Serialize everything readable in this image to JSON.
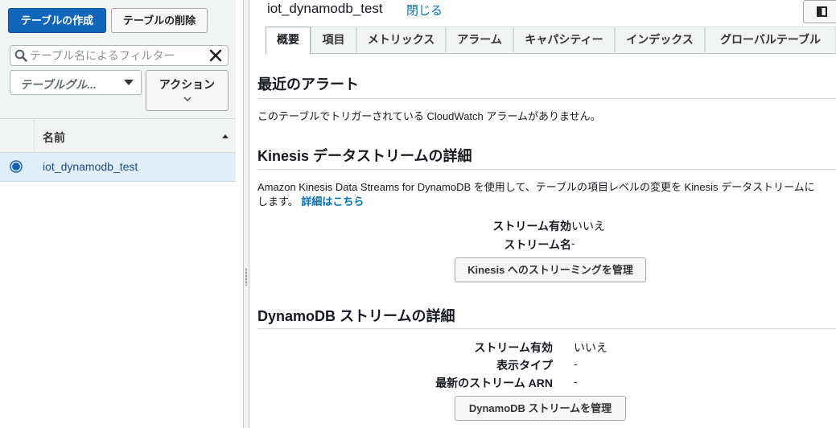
{
  "left": {
    "create_table_label": "テーブルの作成",
    "delete_table_label": "テーブルの削除",
    "filter_placeholder": "テーブル名によるフィルター",
    "table_group_label": "テーブルグル...",
    "actions_label": "アクション",
    "column_name": "名前",
    "rows": [
      {
        "name": "iot_dynamodb_test",
        "selected": true
      }
    ]
  },
  "right": {
    "title": "iot_dynamodb_test",
    "close_label": "閉じる",
    "tabs": [
      {
        "label": "概要",
        "active": true
      },
      {
        "label": "項目"
      },
      {
        "label": "メトリックス"
      },
      {
        "label": "アラーム"
      },
      {
        "label": "キャパシティー"
      },
      {
        "label": "インデックス"
      },
      {
        "label": "グローバルテーブル"
      }
    ],
    "alerts": {
      "heading": "最近のアラート",
      "message": "このテーブルでトリガーされている CloudWatch アラームがありません。"
    },
    "kinesis": {
      "heading": "Kinesis データストリームの詳細",
      "desc_line1": "Amazon Kinesis Data Streams for DynamoDB を使用して、テーブルの項目レベルの変更を Kinesis データストリームに",
      "desc_line2": "します。",
      "learn_more": "詳細はこちら",
      "stream_enabled_label": "ストリーム有効",
      "stream_enabled_value": "いいえ",
      "stream_name_label": "ストリーム名",
      "stream_name_value": "-",
      "manage_button": "Kinesis へのストリーミングを管理"
    },
    "dynamodb_stream": {
      "heading": "DynamoDB ストリームの詳細",
      "stream_enabled_label": "ストリーム有効",
      "stream_enabled_value": "いいえ",
      "view_type_label": "表示タイプ",
      "view_type_value": "-",
      "latest_arn_label": "最新のストリーム ARN",
      "latest_arn_value": "-",
      "manage_button": "DynamoDB ストリームを管理"
    }
  },
  "colors": {
    "primary": "#1166bb",
    "link": "#0073bb",
    "selected_row": "#e1edf8",
    "panel_bg": "#f2f3f3"
  }
}
